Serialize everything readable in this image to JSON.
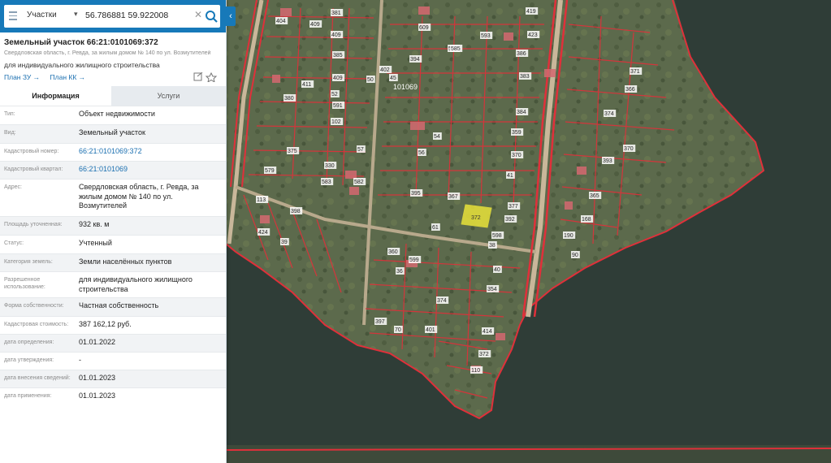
{
  "search": {
    "layer": "Участки",
    "query": "56.786881 59.922008"
  },
  "parcel": {
    "title": "Земельный участок 66:21:0101069:372",
    "address_short": "Свердловская область, г. Ревда, за жилым домом № 140 по ул. Возмутителей",
    "usage_short": "для индивидуального жилищного строительства",
    "links": [
      "План ЗУ →",
      "План КК →"
    ]
  },
  "tabs": [
    "Информация",
    "Услуги"
  ],
  "info_rows": [
    {
      "label": "Тип:",
      "value": "Объект недвижимости"
    },
    {
      "label": "Вид:",
      "value": "Земельный участок"
    },
    {
      "label": "Кадастровый номер:",
      "value": "66:21:0101069:372"
    },
    {
      "label": "Кадастровый квартал:",
      "value": "66:21:0101069"
    },
    {
      "label": "Адрес:",
      "value": "Свердловская область, г. Ревда, за жилым домом № 140 по ул. Возмутителей"
    },
    {
      "label": "Площадь уточненная:",
      "value": "932 кв. м"
    },
    {
      "label": "Статус:",
      "value": "Учтенный"
    },
    {
      "label": "Категория земель:",
      "value": "Земли населённых пунктов"
    },
    {
      "label": "Разрешенное использование:",
      "value": "для индивидуального жилищного строительства"
    },
    {
      "label": "Форма собственности:",
      "value": "Частная собственность"
    },
    {
      "label": "Кадастровая стоимость:",
      "value": "387 162,12 руб."
    },
    {
      "label": "дата определения:",
      "value": "01.01.2022"
    },
    {
      "label": "дата утверждения:",
      "value": "-"
    },
    {
      "label": "дата внесения сведений:",
      "value": "01.01.2023"
    },
    {
      "label": "дата применения:",
      "value": "01.01.2023"
    }
  ],
  "map": {
    "quarter_label": "101069",
    "selected_parcel": "372",
    "parcel_numbers": [
      "404",
      "409",
      "381",
      "409",
      "385",
      "409",
      "419",
      "423",
      "593",
      "609",
      "574",
      "386",
      "411",
      "380",
      "52",
      "50",
      "394",
      "402",
      "383",
      "371",
      "366",
      "102",
      "375",
      "579",
      "57",
      "330",
      "45",
      "591",
      "585",
      "56",
      "54",
      "384",
      "359",
      "370",
      "374",
      "393",
      "370",
      "583",
      "582",
      "395",
      "367",
      "377",
      "365",
      "168",
      "190",
      "113",
      "424",
      "398",
      "392",
      "598",
      "39",
      "38",
      "360",
      "374",
      "354",
      "397",
      "70",
      "401",
      "414",
      "372",
      "110",
      "90",
      "40",
      "36",
      "599",
      "61",
      "41"
    ],
    "colors": {
      "boundary": "#e0303a",
      "selected": "#e8e23a",
      "water": "#2e3b35",
      "land": "#5e6b4e"
    }
  }
}
